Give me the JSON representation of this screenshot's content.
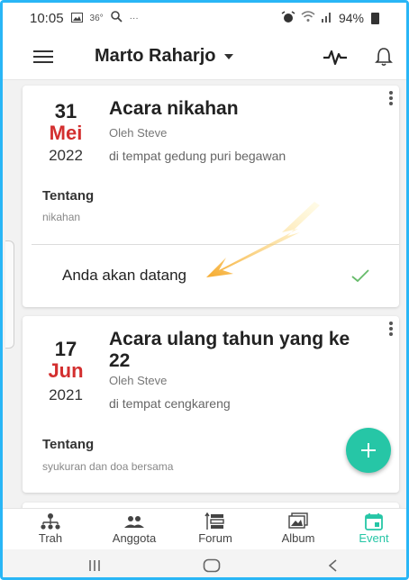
{
  "status_bar": {
    "time": "10:05",
    "temp": "36°",
    "dots": "···",
    "battery": "94%"
  },
  "app_bar": {
    "title": "Marto Raharjo"
  },
  "events": [
    {
      "day": "31",
      "month": "Mei",
      "year": "2022",
      "title": "Acara nikahan",
      "by": "Oleh Steve",
      "location": "di tempat gedung puri begawan",
      "about_label": "Tentang",
      "about_text": "nikahan",
      "attend_text": "Anda akan datang"
    },
    {
      "day": "17",
      "month": "Jun",
      "year": "2021",
      "title": "Acara ulang tahun yang ke 22",
      "by": "Oleh Steve",
      "location": "di tempat cengkareng",
      "about_label": "Tentang",
      "about_text": "syukuran dan doa bersama"
    }
  ],
  "bottom_nav": [
    {
      "label": "Trah",
      "icon": "family-tree-icon"
    },
    {
      "label": "Anggota",
      "icon": "members-icon"
    },
    {
      "label": "Forum",
      "icon": "forum-icon"
    },
    {
      "label": "Album",
      "icon": "album-icon"
    },
    {
      "label": "Event",
      "icon": "calendar-icon",
      "active": true
    }
  ],
  "colors": {
    "accent": "#26c6a6",
    "month_red": "#d32f2f",
    "frame": "#29b6f6",
    "arrow": "#f5a623"
  }
}
